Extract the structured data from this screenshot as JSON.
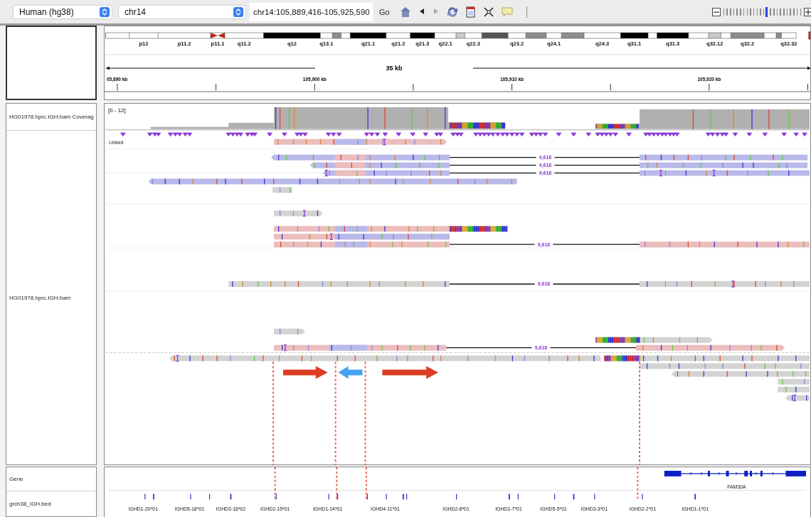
{
  "toolbar": {
    "genome": "Human (hg38)",
    "chromosome": "chr14",
    "locus": "chr14:105,889,416-105,925,590",
    "go_button": "Go",
    "back_enabled": true,
    "forward_enabled": false,
    "zoom": {
      "level": 0.55
    }
  },
  "ideogram": {
    "bands": [
      {
        "color": "#ffffff"
      },
      {
        "label": "p12",
        "color": "#ffffff"
      },
      {
        "label": "p11.2",
        "color": "#ffffff"
      },
      {
        "label": "p11.1",
        "color": "#b8281e"
      },
      {
        "label": "q11.2",
        "color": "#ffffff"
      },
      {
        "label": "q12",
        "color": "#000000"
      },
      {
        "label": "q13.1",
        "color": "#ffffff"
      },
      {
        "color": "#8c8c8c"
      },
      {
        "color": "#ffffff"
      },
      {
        "label": "q21.1",
        "color": "#000000"
      },
      {
        "label": "q21.2",
        "color": "#ffffff"
      },
      {
        "label": "q21.3",
        "color": "#000000"
      },
      {
        "label": "q22.1",
        "color": "#ffffff"
      },
      {
        "color": "#c8c8c8"
      },
      {
        "label": "q22.3",
        "color": "#ffffff"
      },
      {
        "color": "#555555"
      },
      {
        "label": "q23.2",
        "color": "#ffffff"
      },
      {
        "color": "#8c8c8c"
      },
      {
        "label": "q24.1",
        "color": "#ffffff"
      },
      {
        "color": "#8c8c8c"
      },
      {
        "label": "q24.3",
        "color": "#ffffff"
      },
      {
        "label": "q31.1",
        "color": "#000000"
      },
      {
        "color": "#ffffff"
      },
      {
        "label": "q31.3",
        "color": "#000000"
      },
      {
        "color": "#ffffff"
      },
      {
        "label": "q32.12",
        "color": "#c8c8c8"
      },
      {
        "color": "#ffffff"
      },
      {
        "label": "q32.2",
        "color": "#8c8c8c"
      },
      {
        "color": "#ffffff"
      },
      {
        "color": "#8c8c8c"
      },
      {
        "label": "q32.32",
        "color": "#ffffff"
      }
    ]
  },
  "ruler": {
    "span": "35 kb",
    "ticks": [
      "05,890 kb",
      "105,900 kb",
      "105,910 kb",
      "105,920 kb"
    ]
  },
  "coverage_track": {
    "label": "HG01978.hprc.IGH.bam Coverag",
    "range": "[0 - 12]"
  },
  "alignment_track": {
    "label": "HG01978.hprc.IGH.bam",
    "group": "Linked",
    "link_labels": [
      "9,618",
      "9,618",
      "9,618",
      "9,618",
      "9,618",
      "9,618"
    ]
  },
  "gene_track": {
    "label": "Gene",
    "genes": [
      "FAM30A"
    ]
  },
  "bed_track": {
    "label": "grch38_IGH.bed",
    "features": [
      "IGHD1-20*01",
      "IGHD5-18*01",
      "IGHD3-16*02",
      "IGHD2-15*01",
      "IGHD1-14*01",
      "IGHD4-11*01",
      "IGHD2-8*01",
      "IGHD1-7*01",
      "IGHD5-5*01",
      "IGHD3-3*01",
      "IGHD2-2*01",
      "IGHD1-1*01"
    ]
  }
}
